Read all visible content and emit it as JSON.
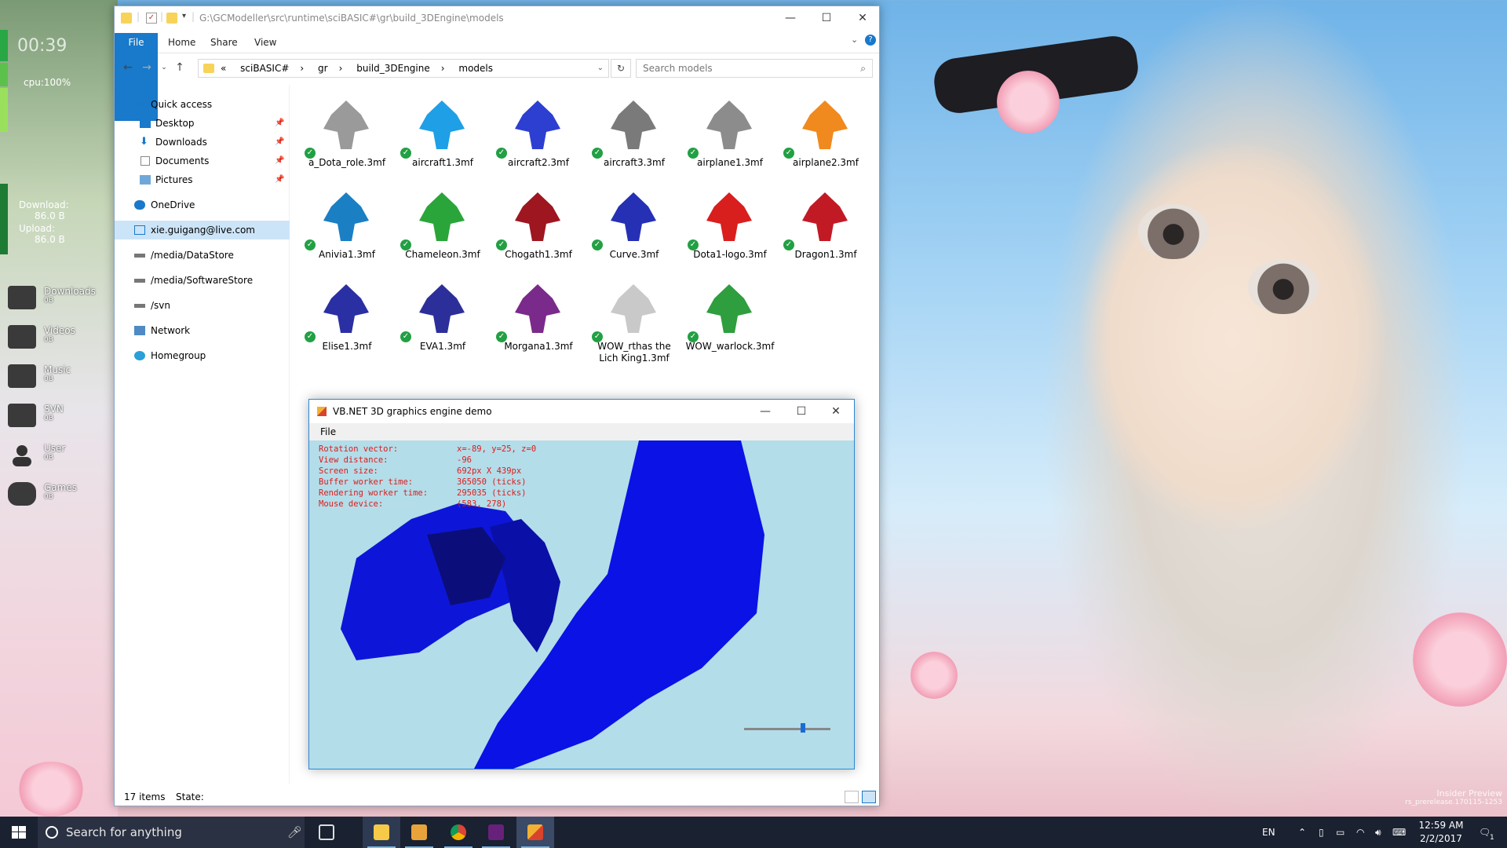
{
  "gadget": {
    "time": "00:39",
    "cpu": "cpu:100%",
    "download_label": "Download:",
    "download_value": "86.0 B",
    "upload_label": "Upload:",
    "upload_value": "86.0 B"
  },
  "desktop": {
    "items": [
      {
        "label": "Downloads",
        "size": "0B",
        "icon": "folder-download-icon"
      },
      {
        "label": "Videos",
        "size": "0B",
        "icon": "folder-video-icon"
      },
      {
        "label": "Music",
        "size": "0B",
        "icon": "music-icon"
      },
      {
        "label": "SVN",
        "size": "0B",
        "icon": "folder-icon"
      },
      {
        "label": "User",
        "size": "0B",
        "icon": "user-icon"
      },
      {
        "label": "Games",
        "size": "0B",
        "icon": "gamepad-icon"
      }
    ]
  },
  "explorer": {
    "title_path": "G:\\GCModeller\\src\\runtime\\sciBASIC#\\gr\\build_3DEngine\\models",
    "ribbon_tabs": [
      "File",
      "Home",
      "Share",
      "View"
    ],
    "address": {
      "prefix": "«",
      "crumbs": [
        "sciBASIC#",
        "gr",
        "build_3DEngine",
        "models"
      ]
    },
    "search_placeholder": "Search models",
    "nav": {
      "quick_access": "Quick access",
      "items": [
        "Desktop",
        "Downloads",
        "Documents",
        "Pictures"
      ],
      "onedrive": "OneDrive",
      "user": "xie.guigang@live.com",
      "drives": [
        "/media/DataStore",
        "/media/SoftwareStore",
        "/svn"
      ],
      "network": "Network",
      "homegroup": "Homegroup"
    },
    "files": [
      {
        "name": "a_Dota_role.3mf",
        "color": "#9a9a9a"
      },
      {
        "name": "aircraft1.3mf",
        "color": "#1e9fe6"
      },
      {
        "name": "aircraft2.3mf",
        "color": "#2d3fd1"
      },
      {
        "name": "aircraft3.3mf",
        "color": "#7a7a7a"
      },
      {
        "name": "airplane1.3mf",
        "color": "#8c8c8c"
      },
      {
        "name": "airplane2.3mf",
        "color": "#f08a1e"
      },
      {
        "name": "Anivia1.3mf",
        "color": "#1b7fc4"
      },
      {
        "name": "Chameleon.3mf",
        "color": "#2aa53a"
      },
      {
        "name": "Chogath1.3mf",
        "color": "#9e1620"
      },
      {
        "name": "Curve.3mf",
        "color": "#2530b5"
      },
      {
        "name": "Dota1-logo.3mf",
        "color": "#d91e1e"
      },
      {
        "name": "Dragon1.3mf",
        "color": "#c21a25"
      },
      {
        "name": "Elise1.3mf",
        "color": "#2a2fa3"
      },
      {
        "name": "EVA1.3mf",
        "color": "#2c2f9a"
      },
      {
        "name": "Morgana1.3mf",
        "color": "#7a2a8a"
      },
      {
        "name": "WOW_rthas the Lich King1.3mf",
        "color": "#c9c9c9"
      },
      {
        "name": "WOW_warlock.3mf",
        "color": "#2e9e3e"
      }
    ],
    "status": {
      "count": "17 items",
      "state": "State:"
    }
  },
  "demo": {
    "title": "VB.NET 3D graphics engine demo",
    "menu": "File",
    "readout": [
      {
        "label": "Rotation vector:",
        "value": "x=-89, y=25, z=0"
      },
      {
        "label": "View distance:",
        "value": "-96"
      },
      {
        "label": "Screen size:",
        "value": "692px X 439px"
      },
      {
        "label": "Buffer worker time:",
        "value": "365050 (ticks)"
      },
      {
        "label": "Rendering worker time:",
        "value": "295035 (ticks)"
      },
      {
        "label": "Mouse device:",
        "value": "(583, 278)"
      }
    ],
    "zoom_level": 0.68,
    "model_color": "#0a12e6"
  },
  "taskbar": {
    "search_text": "Search for anything",
    "language": "EN",
    "time": "12:59 AM",
    "date": "2/2/2017",
    "notifications": "1"
  },
  "watermark": {
    "line1": "Insider Preview",
    "line2": "rs_prerelease.170115-1253"
  },
  "colors": {
    "accent": "#1979ca",
    "taskbar": "#1a2130",
    "readout": "#e01b1b"
  }
}
